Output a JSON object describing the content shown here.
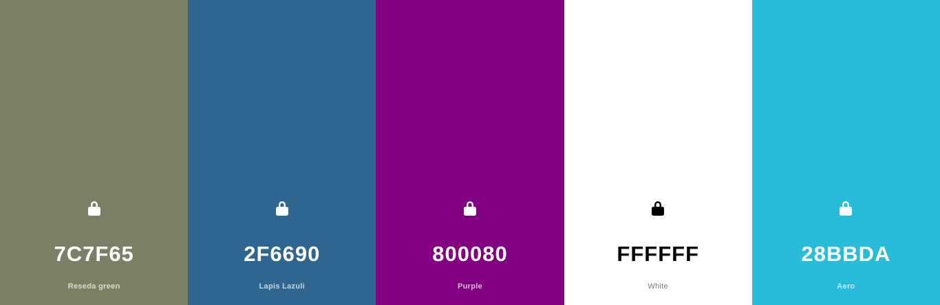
{
  "palette": {
    "swatches": [
      {
        "hex": "7C7F65",
        "name": "Reseda green",
        "color": "#7C7F65",
        "icon": "lock-icon"
      },
      {
        "hex": "2F6690",
        "name": "Lapis Lazuli",
        "color": "#2F6690",
        "icon": "lock-icon"
      },
      {
        "hex": "800080",
        "name": "Purple",
        "color": "#800080",
        "icon": "lock-icon"
      },
      {
        "hex": "FFFFFF",
        "name": "White",
        "color": "#FFFFFF",
        "icon": "lock-icon"
      },
      {
        "hex": "28BBDA",
        "name": "Aero",
        "color": "#28BBDA",
        "icon": "lock-icon"
      }
    ]
  }
}
